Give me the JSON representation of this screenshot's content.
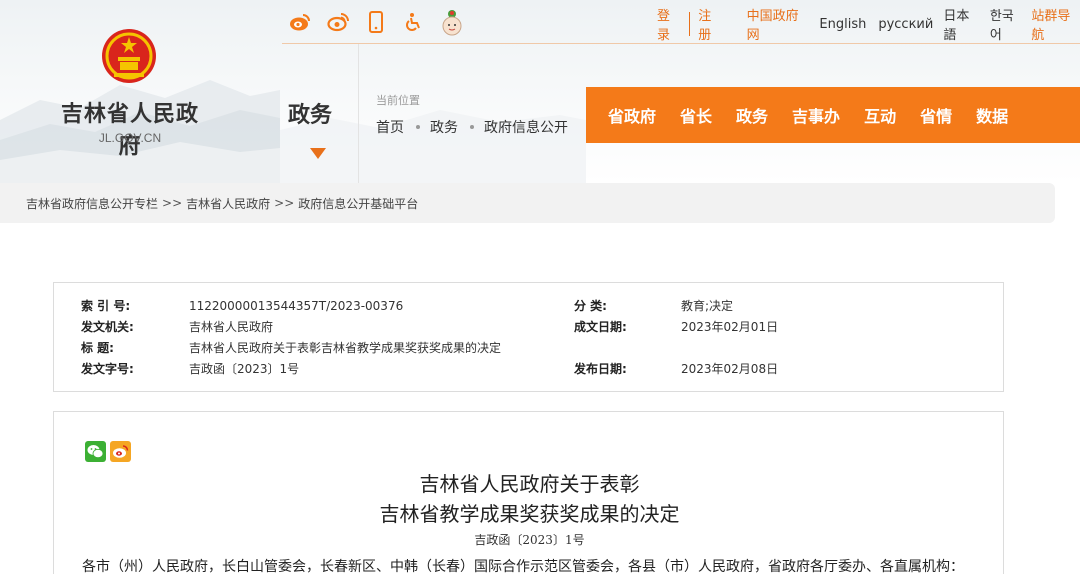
{
  "site": {
    "name": "吉林省人民政府",
    "domain": "JL.GOV.CN"
  },
  "top_bar": {
    "icons": [
      "weibo-icon",
      "weibo-icon",
      "mobile-icon",
      "accessibility-icon",
      "mascot-icon"
    ],
    "links": [
      "登录",
      "注册",
      "中国政府网",
      "English",
      "русский",
      "日本語",
      "한국어",
      "站群导航"
    ],
    "colors": {
      "accent": "#f47a19",
      "link_accent": "#e8701a"
    }
  },
  "channel": {
    "name": "政务"
  },
  "position": {
    "label": "当前位置",
    "crumbs": [
      "首页",
      "政务",
      "政府信息公开"
    ]
  },
  "nav": {
    "items": [
      "省政府",
      "省长",
      "政务",
      "吉事办",
      "互动",
      "省情",
      "数据"
    ]
  },
  "breadcrumb": {
    "items": [
      "吉林省政府信息公开专栏",
      "吉林省人民政府",
      "政府信息公开基础平台"
    ],
    "separator": ">>"
  },
  "info": {
    "index_no_label": "索 引 号:",
    "index_no": "11220000013544357T/2023-00376",
    "category_label": "分    类:",
    "category": "教育;决定",
    "issuer_label": "发文机关:",
    "issuer": "吉林省人民政府",
    "written_date_label": "成文日期:",
    "written_date": "2023年02月01日",
    "title_label": "标      题:",
    "title": "吉林省人民政府关于表彰吉林省教学成果奖获奖成果的决定",
    "doc_no_label": "发文字号:",
    "doc_no": "吉政函〔2023〕1号",
    "publish_date_label": "发布日期:",
    "publish_date": "2023年02月08日"
  },
  "document": {
    "share_icons": [
      "wechat-icon",
      "weibo-icon"
    ],
    "title_line1": "吉林省人民政府关于表彰",
    "title_line2": "吉林省教学成果奖获奖成果的决定",
    "number": "吉政函〔2023〕1号",
    "body_first_line": "各市（州）人民政府，长白山管委会，长春新区、中韩（长春）国际合作示范区管委会，各县（市）人民政府，省政府各厅委办、各直属机构："
  }
}
